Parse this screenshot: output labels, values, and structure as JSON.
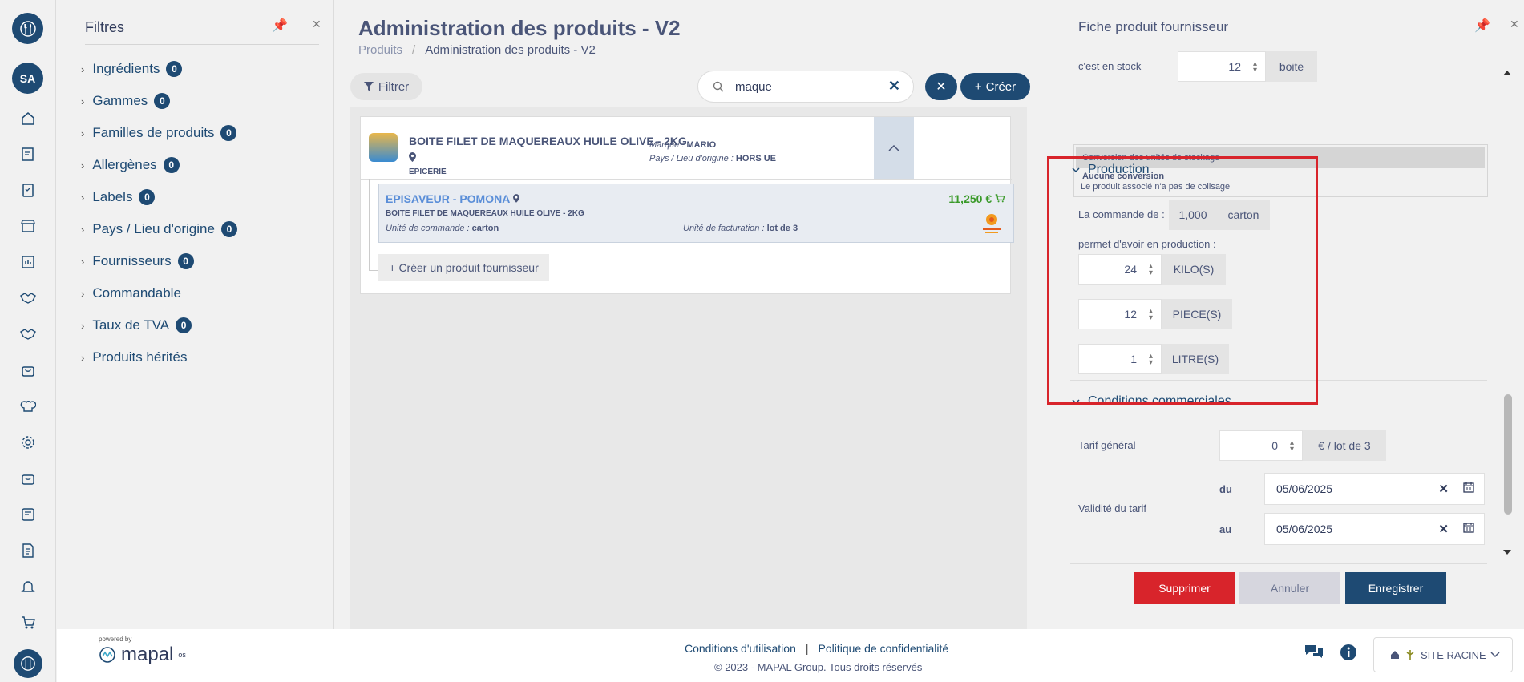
{
  "nav": {
    "avatar_initials": "SA"
  },
  "filters": {
    "title": "Filtres",
    "items": [
      {
        "label": "Ingrédients",
        "count": "0"
      },
      {
        "label": "Gammes",
        "count": "0"
      },
      {
        "label": "Familles de produits",
        "count": "0"
      },
      {
        "label": "Allergènes",
        "count": "0"
      },
      {
        "label": "Labels",
        "count": "0"
      },
      {
        "label": "Pays / Lieu d'origine",
        "count": "0"
      },
      {
        "label": "Fournisseurs",
        "count": "0"
      },
      {
        "label": "Commandable",
        "count": null
      },
      {
        "label": "Taux de TVA",
        "count": "0"
      },
      {
        "label": "Produits hérités",
        "count": null
      }
    ]
  },
  "main": {
    "title": "Administration des produits - V2",
    "breadcrumb": {
      "parent": "Produits",
      "current": "Administration des produits - V2"
    },
    "filter_button": "Filtrer",
    "search_value": "maque",
    "create_button": "Créer",
    "product": {
      "name": "BOITE FILET DE MAQUEREAUX HUILE OLIVE - 2KG",
      "category": "EPICERIE",
      "brand_label": "Marque : ",
      "brand": "MARIO",
      "origin_label": "Pays / Lieu d'origine : ",
      "origin": "HORS UE"
    },
    "supplier": {
      "name": "EPISAVEUR - POMONA",
      "price": "11,250 €",
      "product": "BOITE FILET DE MAQUEREAUX HUILE OLIVE - 2KG",
      "order_unit_label": "Unité de commande : ",
      "order_unit": "carton",
      "billing_unit_label": "Unité de facturation : ",
      "billing_unit": "lot de 3"
    },
    "create_supplier_product": "Créer un produit fournisseur"
  },
  "right": {
    "title": "Fiche produit fournisseur",
    "stock_label": "c'est en stock",
    "stock_value": "12",
    "stock_unit": "boite",
    "conversion_header": "Conversion des unités de stockage",
    "conversion_none": "Aucune conversion",
    "conversion_note": "Le produit associé n'a pas de colisage",
    "production": {
      "title": "Production",
      "order_label": "La commande de :",
      "order_value": "1,000",
      "order_unit": "carton",
      "gives_label": "permet d'avoir en production :",
      "rows": [
        {
          "value": "24",
          "unit": "KILO(S)"
        },
        {
          "value": "12",
          "unit": "PIECE(S)"
        },
        {
          "value": "1",
          "unit": "LITRE(S)"
        }
      ]
    },
    "commercial": {
      "title": "Conditions commerciales",
      "tarif_label": "Tarif général",
      "tarif_value": "0",
      "tarif_unit": "€ / lot de 3",
      "validity_label": "Validité du tarif",
      "from_label": "du",
      "from_value": "05/06/2025",
      "to_label": "au",
      "to_value": "05/06/2025"
    },
    "buttons": {
      "delete": "Supprimer",
      "cancel": "Annuler",
      "save": "Enregistrer"
    }
  },
  "footer": {
    "powered_by": "powered by",
    "brand": "mapal",
    "brand_suffix": "os",
    "terms": "Conditions d'utilisation",
    "separator": "|",
    "privacy": "Politique de confidentialité",
    "copyright": "© 2023 - MAPAL Group. Tous droits réservés",
    "site": "SITE RACINE"
  },
  "colors": {
    "primary": "#1e4a73",
    "danger": "#d8242b",
    "price": "#3a9a2a",
    "supplier_link": "#5a8ed8"
  }
}
